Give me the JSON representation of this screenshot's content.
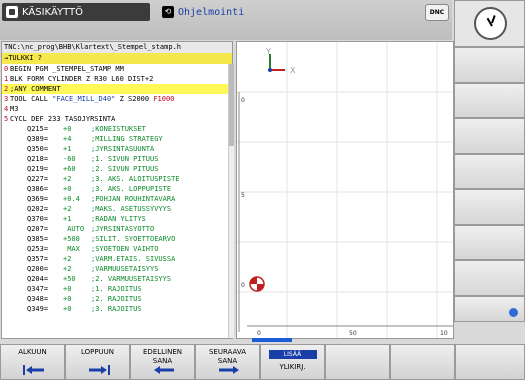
{
  "header": {
    "mode_manual": "KÄSIKÄYTTÖ",
    "mode_program": "Ohjelmointi",
    "dnc": "DNC"
  },
  "program": {
    "path": "TNC:\\nc_prog\\BHB\\Klartext\\_Stempel_stamp.h",
    "mode_label": "→TULKKI ?",
    "lines": [
      {
        "n": "0",
        "t": "BEGIN PGM _STEMPEL_STAMP MM"
      },
      {
        "n": "1",
        "t": "BLK FORM CYLINDER Z R30 L60 DIST+2"
      },
      {
        "n": "2",
        "t": ";ANY COMMENT"
      },
      {
        "n": "3",
        "t": "TOOL CALL \"FACE_MILL_D40\" Z S2000 F1000"
      },
      {
        "n": "4",
        "t": "M3"
      },
      {
        "n": "5",
        "t": "CYCL DEF 233 TASOJYRSINTA"
      }
    ],
    "params": [
      {
        "nm": "Q215=",
        "vl": "+0",
        "cm": ";KONEISTUKSET"
      },
      {
        "nm": "Q389=",
        "vl": "+4",
        "cm": ";MILLING STRATEGY"
      },
      {
        "nm": "Q350=",
        "vl": "+1",
        "cm": ";JYRSINTASUUNTA"
      },
      {
        "nm": "Q218=",
        "vl": "-60",
        "cm": ";1. SIVUN PITUUS"
      },
      {
        "nm": "Q219=",
        "vl": "+60",
        "cm": ";2. SIVUN PITUUS"
      },
      {
        "nm": "Q227=",
        "vl": "+2",
        "cm": ";3. AKS. ALOITUSPISTE"
      },
      {
        "nm": "Q386=",
        "vl": "+0",
        "cm": ";3. AKS. LOPPUPISTE"
      },
      {
        "nm": "Q369=",
        "vl": "+0.4",
        "cm": ";POHJAN ROUHINTAVARA"
      },
      {
        "nm": "Q202=",
        "vl": "+2",
        "cm": ";MAKS. ASETUSSYVYYS"
      },
      {
        "nm": "Q370=",
        "vl": "+1",
        "cm": ";RADAN YLITYS"
      },
      {
        "nm": "Q207=",
        "vl": " AUTO",
        "cm": ";JYRSINTASYOTTO"
      },
      {
        "nm": "Q385=",
        "vl": "+500",
        "cm": ";SILIT. SYOETTOEARVO"
      },
      {
        "nm": "Q253=",
        "vl": " MAX",
        "cm": ";SYOETOEN VAIHTO"
      },
      {
        "nm": "Q357=",
        "vl": "+2",
        "cm": ";VARM.ETAIS. SIVUSSA"
      },
      {
        "nm": "Q200=",
        "vl": "+2",
        "cm": ";VARMUUSETAISYYS"
      },
      {
        "nm": "Q204=",
        "vl": "+50",
        "cm": ";2. VARMUUSETAISYYS"
      },
      {
        "nm": "Q347=",
        "vl": "+0",
        "cm": ";1. RAJOITUS"
      },
      {
        "nm": "Q348=",
        "vl": "+0",
        "cm": ";2. RAJOITUS"
      },
      {
        "nm": "Q349=",
        "vl": "+0",
        "cm": ";3. RAJOITUS"
      }
    ]
  },
  "graphics": {
    "axis_y": "Y",
    "axis_x": "X",
    "ruler_left": [
      "0",
      "5",
      "0"
    ],
    "ruler_bottom": [
      "0",
      "50",
      "10"
    ]
  },
  "softkeys": {
    "b1": [
      "ALKUUN",
      ""
    ],
    "b2": [
      "LOPPUUN",
      ""
    ],
    "b3": [
      "EDELLINEN",
      "SANA"
    ],
    "b4": [
      "SEURAAVA",
      "SANA"
    ],
    "b5": [
      "LISÄÄ",
      "YLIKIRJ."
    ]
  },
  "colors": {
    "accent": "#1a3ea8",
    "highlight": "#fffa5a",
    "comment": "#0b8a2a",
    "line_no": "#c0001e"
  }
}
